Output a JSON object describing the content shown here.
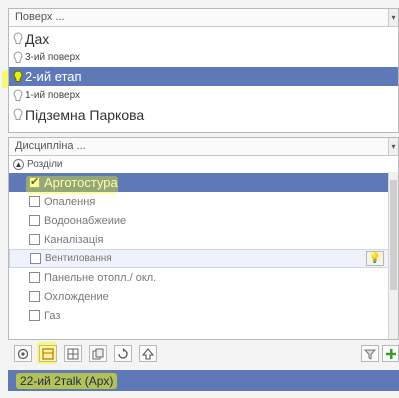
{
  "floors": {
    "header": "Поверх ...",
    "items": [
      {
        "label": "Дах"
      },
      {
        "label": "3-ий поверх"
      },
      {
        "label": "2-ий етап"
      },
      {
        "label": "1-ий поверх"
      },
      {
        "label": "Підземна Паркова"
      }
    ]
  },
  "disciplines": {
    "header": "Дисципліна ...",
    "group": "Розділи",
    "items": [
      {
        "label": "Арготостура",
        "checked": true
      },
      {
        "label": "Опалення",
        "checked": false
      },
      {
        "label": "Водоонабжеиие",
        "checked": false
      },
      {
        "label": "Каналізація",
        "checked": false
      },
      {
        "label": "Вентиловання",
        "checked": false
      },
      {
        "label": "Панельне отопл./ окл.",
        "checked": false
      },
      {
        "label": "Охлождение",
        "checked": false
      },
      {
        "label": "Газ",
        "checked": false
      }
    ]
  },
  "status": {
    "text": "22-ий 2таlk (Арх)"
  },
  "colors": {
    "selection": "#5f79b8",
    "highlight": "#f7ff00"
  }
}
